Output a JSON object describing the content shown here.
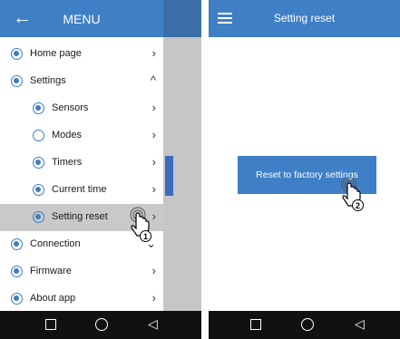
{
  "phone1": {
    "header": {
      "back_icon": "arrow-left-icon",
      "title": "MENU"
    },
    "menu": [
      {
        "label": "Home page",
        "icon": "home-icon",
        "chevron": "›",
        "level": 1
      },
      {
        "label": "Settings",
        "icon": "settings-icon",
        "chevron": "^",
        "level": 1
      },
      {
        "label": "Sensors",
        "icon": "sensors-icon",
        "chevron": "›",
        "level": 2
      },
      {
        "label": "Modes",
        "icon": "modes-icon",
        "chevron": "›",
        "level": 2
      },
      {
        "label": "Timers",
        "icon": "timer-icon",
        "chevron": "›",
        "level": 2
      },
      {
        "label": "Current time",
        "icon": "clock-icon",
        "chevron": "›",
        "level": 2
      },
      {
        "label": "Setting reset",
        "icon": "reset-icon",
        "chevron": "›",
        "level": 2,
        "selected": true
      },
      {
        "label": "Connection",
        "icon": "connection-icon",
        "chevron": "⌄",
        "level": 1
      },
      {
        "label": "Firmware",
        "icon": "firmware-icon",
        "chevron": "›",
        "level": 1
      },
      {
        "label": "About app",
        "icon": "info-icon",
        "chevron": "›",
        "level": 1
      }
    ],
    "gesture_step": "1"
  },
  "phone2": {
    "header": {
      "menu_icon": "hamburger-icon",
      "title": "Setting reset"
    },
    "reset_button": "Reset to factory settings",
    "gesture_step": "2"
  },
  "nav": {
    "triangle": "◁"
  },
  "colors": {
    "accent": "#3f7fc6",
    "selected_row": "#c9c9c9",
    "navbar": "#111111"
  }
}
